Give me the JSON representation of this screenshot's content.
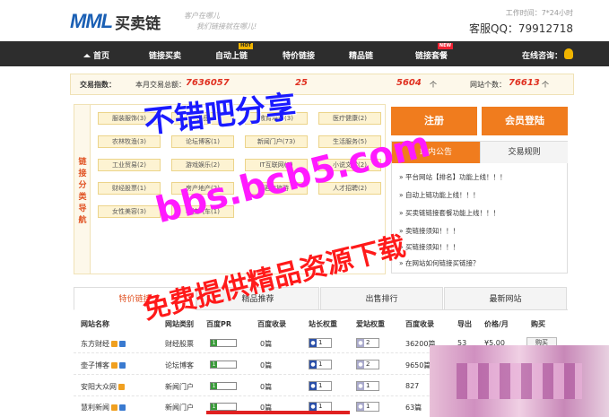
{
  "header": {
    "logo_mark": "MML",
    "logo_text": "买卖链",
    "slogan_line1": "客户在哪儿",
    "slogan_line2": "我们链接就在哪儿!",
    "worktime": "工作时间：7*24小时",
    "hotline": "客服QQ：79912718"
  },
  "nav": {
    "items": [
      {
        "label": "首页",
        "badge": ""
      },
      {
        "label": "链接买卖",
        "badge": ""
      },
      {
        "label": "自动上链",
        "badge": "HOT"
      },
      {
        "label": "特价链接",
        "badge": ""
      },
      {
        "label": "精品链",
        "badge": ""
      },
      {
        "label": "链接套餐",
        "badge": "NEW"
      }
    ],
    "consult": "在线咨询："
  },
  "stats": {
    "label": "交易指数：",
    "trade_label": "本月交易总额：",
    "trade_value": "7636057",
    "mid_value": "25",
    "link_value": "5604",
    "link_unit": "个",
    "site_label": "网站个数：",
    "site_value": "76613",
    "site_unit": "个"
  },
  "categories": {
    "side_label": "链接分类导航",
    "chips": [
      "服装服饰(3)",
      "食品",
      "教育培训(3)",
      "医疗健康(2)",
      "农林牧渔(3)",
      "论坛博客(1)",
      "新闻门户(73)",
      "生活服务(5)",
      "工业贸易(2)",
      "游戏娱乐(2)",
      "IT互联网(1)",
      "小说文学(2)",
      "财经股票(1)",
      "房产地产(2)",
      "酒店旅游",
      "人才招聘(2)",
      "女性美容(3)",
      "科技汽车(1)"
    ]
  },
  "auth": {
    "register": "注册",
    "login": "会员登陆"
  },
  "notice": {
    "tab_active": "站内公告",
    "tab_inactive": "交易规则",
    "items": [
      "» 平台网站【排名】功能上线！！！",
      "» 自动上链功能上线！！！",
      "» 买卖链链接套餐功能上线！！！",
      "» 卖链接须知！！！",
      "» 买链接须知！！！",
      "» 在网站如何链接买链接？"
    ]
  },
  "table": {
    "tabs": [
      "特价链接",
      "精品推荐",
      "出售排行",
      "最新网站"
    ],
    "headers": [
      "网站名称",
      "网站类别",
      "百度PR",
      "百度收录",
      "站长权重",
      "爱站权重",
      "百度收录",
      "导出",
      "价格/月",
      "购买"
    ],
    "rows": [
      {
        "name": "东方财经",
        "category": "财经股票",
        "pr": "1",
        "record": "0篇",
        "weight1": "1",
        "weight2": "2",
        "indexed": "36200篇",
        "export": "53",
        "price": "¥5.00",
        "buy": "购买"
      },
      {
        "name": "壶子博客",
        "category": "论坛博客",
        "pr": "1",
        "record": "0篇",
        "weight1": "1",
        "weight2": "2",
        "indexed": "9650篇",
        "export": "",
        "price": "",
        "buy": ""
      },
      {
        "name": "安阳大众网",
        "category": "新闻门户",
        "pr": "1",
        "record": "0篇",
        "weight1": "1",
        "weight2": "1",
        "indexed": "827",
        "export": "",
        "price": "",
        "buy": ""
      },
      {
        "name": "慧利新闻",
        "category": "新闻门户",
        "pr": "1",
        "record": "0篇",
        "weight1": "1",
        "weight2": "1",
        "indexed": "63篇",
        "export": "",
        "price": "",
        "buy": ""
      }
    ]
  },
  "watermarks": {
    "line1": "不错吧分享",
    "line2": "bbs.bcb5.com",
    "line3": "免费提供精品资源下载"
  },
  "colors": {
    "accent": "#f07c1e",
    "nav_bg": "#2d2d2d",
    "stats_num": "#e03020"
  }
}
